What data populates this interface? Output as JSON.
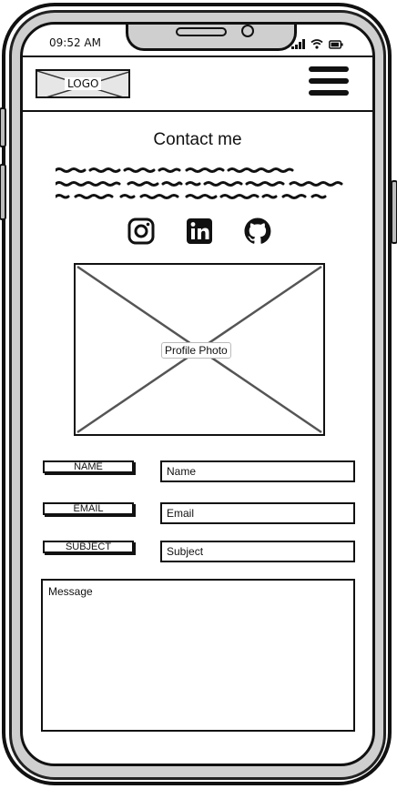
{
  "status_bar": {
    "time": "09:52 AM"
  },
  "header": {
    "logo_text": "LOGO"
  },
  "page": {
    "title": "Contact me"
  },
  "social": [
    "instagram-icon",
    "linkedin-icon",
    "github-icon"
  ],
  "photo": {
    "label": "Profile Photo"
  },
  "form": {
    "name_label": "NAME",
    "name_placeholder": "Name",
    "email_label": "EMAIL",
    "email_placeholder": "Email",
    "subject_label": "SUBJECT",
    "subject_placeholder": "Subject",
    "message_placeholder": "Message"
  }
}
